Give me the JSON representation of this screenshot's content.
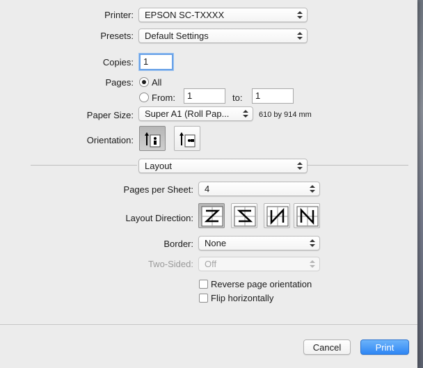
{
  "printer": {
    "label": "Printer:",
    "value": "EPSON SC-TXXXX"
  },
  "presets": {
    "label": "Presets:",
    "value": "Default Settings"
  },
  "copies": {
    "label": "Copies:",
    "value": "1"
  },
  "pages": {
    "label": "Pages:",
    "all_label": "All",
    "from_label": "From:",
    "from_value": "1",
    "to_label": "to:",
    "to_value": "1",
    "selected": "All"
  },
  "paper_size": {
    "label": "Paper Size:",
    "value": "Super A1 (Roll Pap...",
    "dimensions": "610 by 914 mm"
  },
  "orientation": {
    "label": "Orientation:",
    "options": [
      "portrait-icon",
      "landscape-icon"
    ],
    "selected": "portrait"
  },
  "section": {
    "value": "Layout"
  },
  "pages_per_sheet": {
    "label": "Pages per Sheet:",
    "value": "4"
  },
  "layout_direction": {
    "label": "Layout Direction:",
    "options": [
      "z-direction-icon",
      "reverse-z-direction-icon",
      "n-direction-icon",
      "reverse-n-direction-icon"
    ],
    "selected": 0
  },
  "border": {
    "label": "Border:",
    "value": "None"
  },
  "two_sided": {
    "label": "Two-Sided:",
    "value": "Off",
    "enabled": false
  },
  "checkboxes": [
    {
      "label": "Reverse page orientation",
      "checked": false
    },
    {
      "label": "Flip horizontally",
      "checked": false
    }
  ],
  "buttons": {
    "cancel": "Cancel",
    "print": "Print"
  },
  "colors": {
    "accent": "#2e86f4",
    "background": "#ececec"
  }
}
